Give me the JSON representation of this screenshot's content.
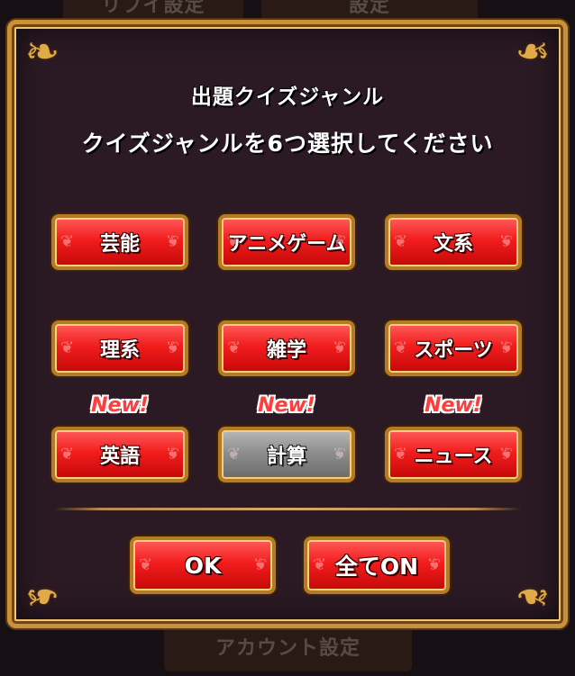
{
  "background": {
    "top_left_label": "リプイ設定",
    "top_right_label": "設定",
    "bottom_label": "アカウント設定"
  },
  "dialog": {
    "title": "出題クイズジャンル",
    "instruction": "クイズジャンルを6つ選択してください",
    "new_badge_label": "New!",
    "genres": [
      {
        "label": "芸能",
        "selected": true,
        "is_new": false
      },
      {
        "label": "アニメゲーム",
        "selected": true,
        "is_new": false
      },
      {
        "label": "文系",
        "selected": true,
        "is_new": false
      },
      {
        "label": "理系",
        "selected": true,
        "is_new": false
      },
      {
        "label": "雑学",
        "selected": true,
        "is_new": false
      },
      {
        "label": "スポーツ",
        "selected": true,
        "is_new": false
      },
      {
        "label": "英語",
        "selected": true,
        "is_new": true
      },
      {
        "label": "計算",
        "selected": false,
        "is_new": true
      },
      {
        "label": "ニュース",
        "selected": true,
        "is_new": true
      }
    ],
    "ok_label": "OK",
    "all_on_label": "全てON"
  },
  "colors": {
    "button_on": "#f21d1d",
    "button_off": "#8e8e8e",
    "frame_gold": "#c9923a",
    "panel_bg": "#2b1a24",
    "new_badge": "#ff3d3d"
  }
}
